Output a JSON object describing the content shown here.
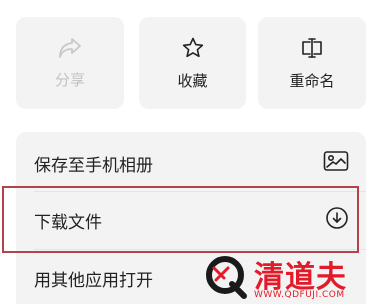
{
  "actions": {
    "share": {
      "label": "分享",
      "icon": "share-icon",
      "disabled": true
    },
    "favorite": {
      "label": "收藏",
      "icon": "star-icon"
    },
    "rename": {
      "label": "重命名",
      "icon": "rename-icon"
    }
  },
  "menu": {
    "items": [
      {
        "label": "保存至手机相册",
        "icon": "image-icon"
      },
      {
        "label": "下载文件",
        "icon": "download-icon",
        "highlighted": true
      },
      {
        "label": "用其他应用打开",
        "icon": ""
      }
    ]
  },
  "watermark": {
    "title": "清道夫",
    "url": "WWW.QDFUJI.COM",
    "color": "#e21b2a"
  },
  "colors": {
    "tile_bg": "#f3f3f3",
    "highlight_border": "#b4424b",
    "disabled_text": "#c2c2c2"
  }
}
